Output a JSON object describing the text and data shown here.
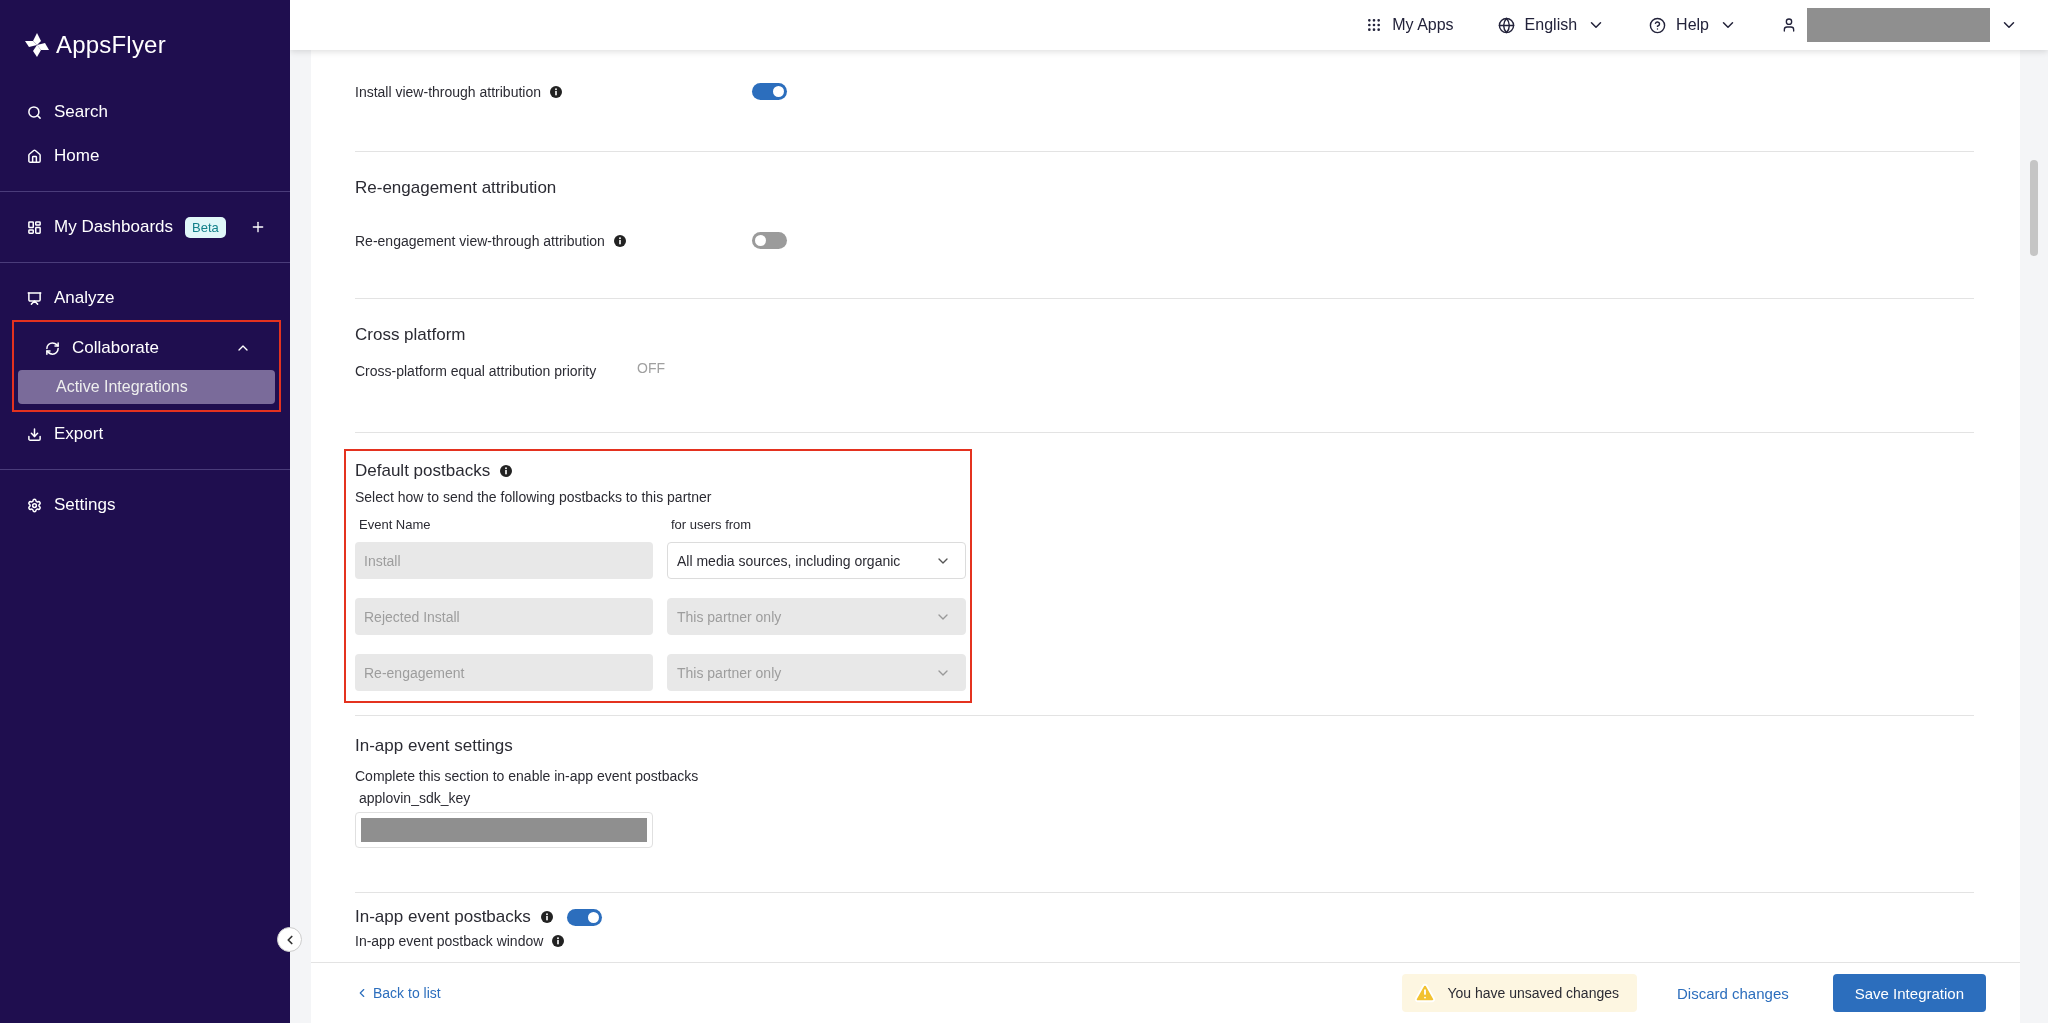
{
  "sidebar": {
    "logo": "AppsFlyer",
    "groups": [
      [
        {
          "kind": "search",
          "label": "Search",
          "selected": false
        },
        {
          "kind": "home",
          "label": "Home",
          "selected": false
        }
      ],
      [
        {
          "kind": "dashboards",
          "label": "My Dashboards",
          "badge": "Beta",
          "selected": false
        }
      ],
      [
        {
          "kind": "analyze",
          "label": "Analyze",
          "selected": false
        },
        {
          "kind": "collaborate",
          "label": "Collaborate",
          "selected": false,
          "expanded": true,
          "children": [
            {
              "label": "Active Integrations",
              "selected": true
            }
          ]
        },
        {
          "kind": "export",
          "label": "Export",
          "selected": false
        }
      ],
      [
        {
          "kind": "settings",
          "label": "Settings",
          "selected": false
        }
      ]
    ]
  },
  "topbar": {
    "my_apps": "My Apps",
    "language": "English",
    "help": "Help"
  },
  "install_view_through": {
    "label": "Install view-through attribution",
    "on": true
  },
  "re_engagement": {
    "title": "Re-engagement attribution",
    "view_through": {
      "label": "Re-engagement view-through attribution",
      "on": false
    }
  },
  "cross_platform": {
    "title": "Cross platform",
    "priority": {
      "label": "Cross-platform equal attribution priority",
      "value": "OFF"
    }
  },
  "default_postbacks": {
    "title": "Default postbacks",
    "description": "Select how to send the following postbacks to this partner",
    "columns": [
      "Event Name",
      "for users from"
    ],
    "rows": [
      {
        "event": "Install",
        "users_from": "All media sources, including organic",
        "users_from_disabled": false
      },
      {
        "event": "Rejected Install",
        "users_from": "This partner only",
        "users_from_disabled": true
      },
      {
        "event": "Re-engagement",
        "users_from": "This partner only",
        "users_from_disabled": true
      }
    ]
  },
  "in_app_settings": {
    "title": "In-app event settings",
    "description": "Complete this section to enable in-app event postbacks",
    "field_label": "applovin_sdk_key"
  },
  "in_app_postbacks": {
    "label": "In-app event postbacks",
    "on": true,
    "window_label": "In-app event postback window"
  },
  "footer": {
    "back": "Back to list",
    "warning": "You have unsaved changes",
    "discard": "Discard changes",
    "save": "Save Integration"
  }
}
